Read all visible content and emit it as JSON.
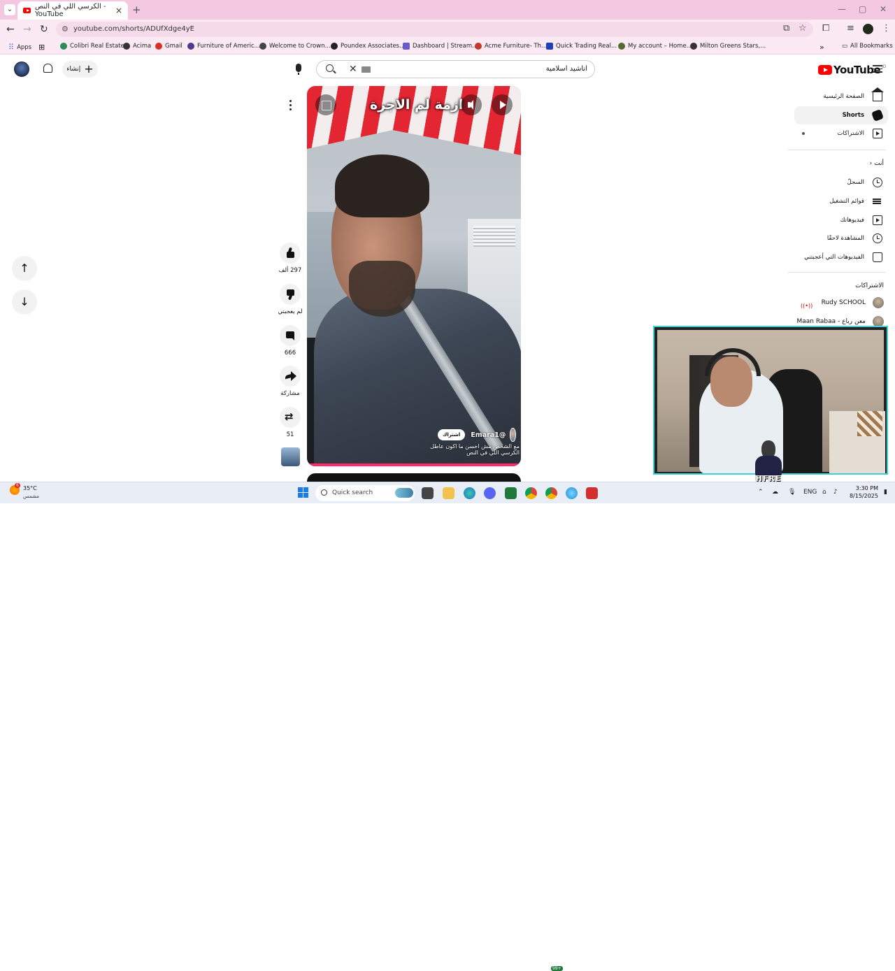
{
  "browser": {
    "tab_title": "الكرسي اللي في النص - YouTube",
    "new_tab": "+",
    "url": "youtube.com/shorts/ADUfXdge4yE",
    "bookmarks": [
      {
        "label": "Apps",
        "color": "#4a7bd0"
      },
      {
        "label": "Colibri Real Estate",
        "color": "#2e8b57"
      },
      {
        "label": "Acima",
        "color": "#333333"
      },
      {
        "label": "Gmail",
        "color": "#d93025"
      },
      {
        "label": "Furniture of Americ...",
        "color": "#4b3b8f"
      },
      {
        "label": "Welcome to Crown...",
        "color": "#444444"
      },
      {
        "label": "Poundex Associates...",
        "color": "#222222"
      },
      {
        "label": "Dashboard | Stream...",
        "color": "#6a5acd"
      },
      {
        "label": "Acme Furniture- Th...",
        "color": "#c0392b"
      },
      {
        "label": "Quick Trading Real...",
        "color": "#1f3fbf"
      },
      {
        "label": "My account – Home...",
        "color": "#556b2f"
      },
      {
        "label": "Milton Greens Stars,...",
        "color": "#333333"
      }
    ],
    "all_bookmarks": "All Bookmarks"
  },
  "header": {
    "logo_text": "YouTube",
    "logo_country": "JO",
    "search_query": "اناشيد اسلامية",
    "create_label": "إنشاء"
  },
  "sidebar": {
    "main": [
      {
        "label": "الصفحة الرئيسية",
        "icon": "home-icon"
      },
      {
        "label": "Shorts",
        "icon": "shorts-icon",
        "active": true
      },
      {
        "label": "الاشتراكات",
        "icon": "subscriptions-icon"
      }
    ],
    "you_heading": "أنت",
    "you": [
      {
        "label": "السجلّ",
        "icon": "history-icon"
      },
      {
        "label": "قوائم التشغيل",
        "icon": "playlists-icon"
      },
      {
        "label": "فيديوهاتك",
        "icon": "your-videos-icon"
      },
      {
        "label": "المشاهدة لاحقًا",
        "icon": "watch-later-icon"
      },
      {
        "label": "الفيديوهات التي أعجبتني",
        "icon": "liked-videos-icon"
      }
    ],
    "subs_heading": "الاشتراكات",
    "subs": [
      {
        "label": "Rudy SCHOOL"
      },
      {
        "label": "معن رباع - Maan Rabaa"
      }
    ]
  },
  "short": {
    "overlay_title": "ازمة لم الاجرة",
    "channel": "@Emara1",
    "subscribe": "اشتراك",
    "caption_line1": "الكرسي اللي في النص",
    "caption_line2": "مع الشخص مش احسن ما اكون عاطل",
    "likes": "297 ألف",
    "dislike_label": "لم يعجبني",
    "comments": "666",
    "share_label": "مشاركة",
    "remixes": "51"
  },
  "stream_overlay": {
    "logo_text": "HFRE"
  },
  "taskbar": {
    "temp": "35°C",
    "condition": "مشمس",
    "weather_badge": "6",
    "search_placeholder": "Quick search",
    "lang": "ENG",
    "time": "3:30 PM",
    "date": "8/15/2025",
    "chrome_badge": "99+"
  }
}
